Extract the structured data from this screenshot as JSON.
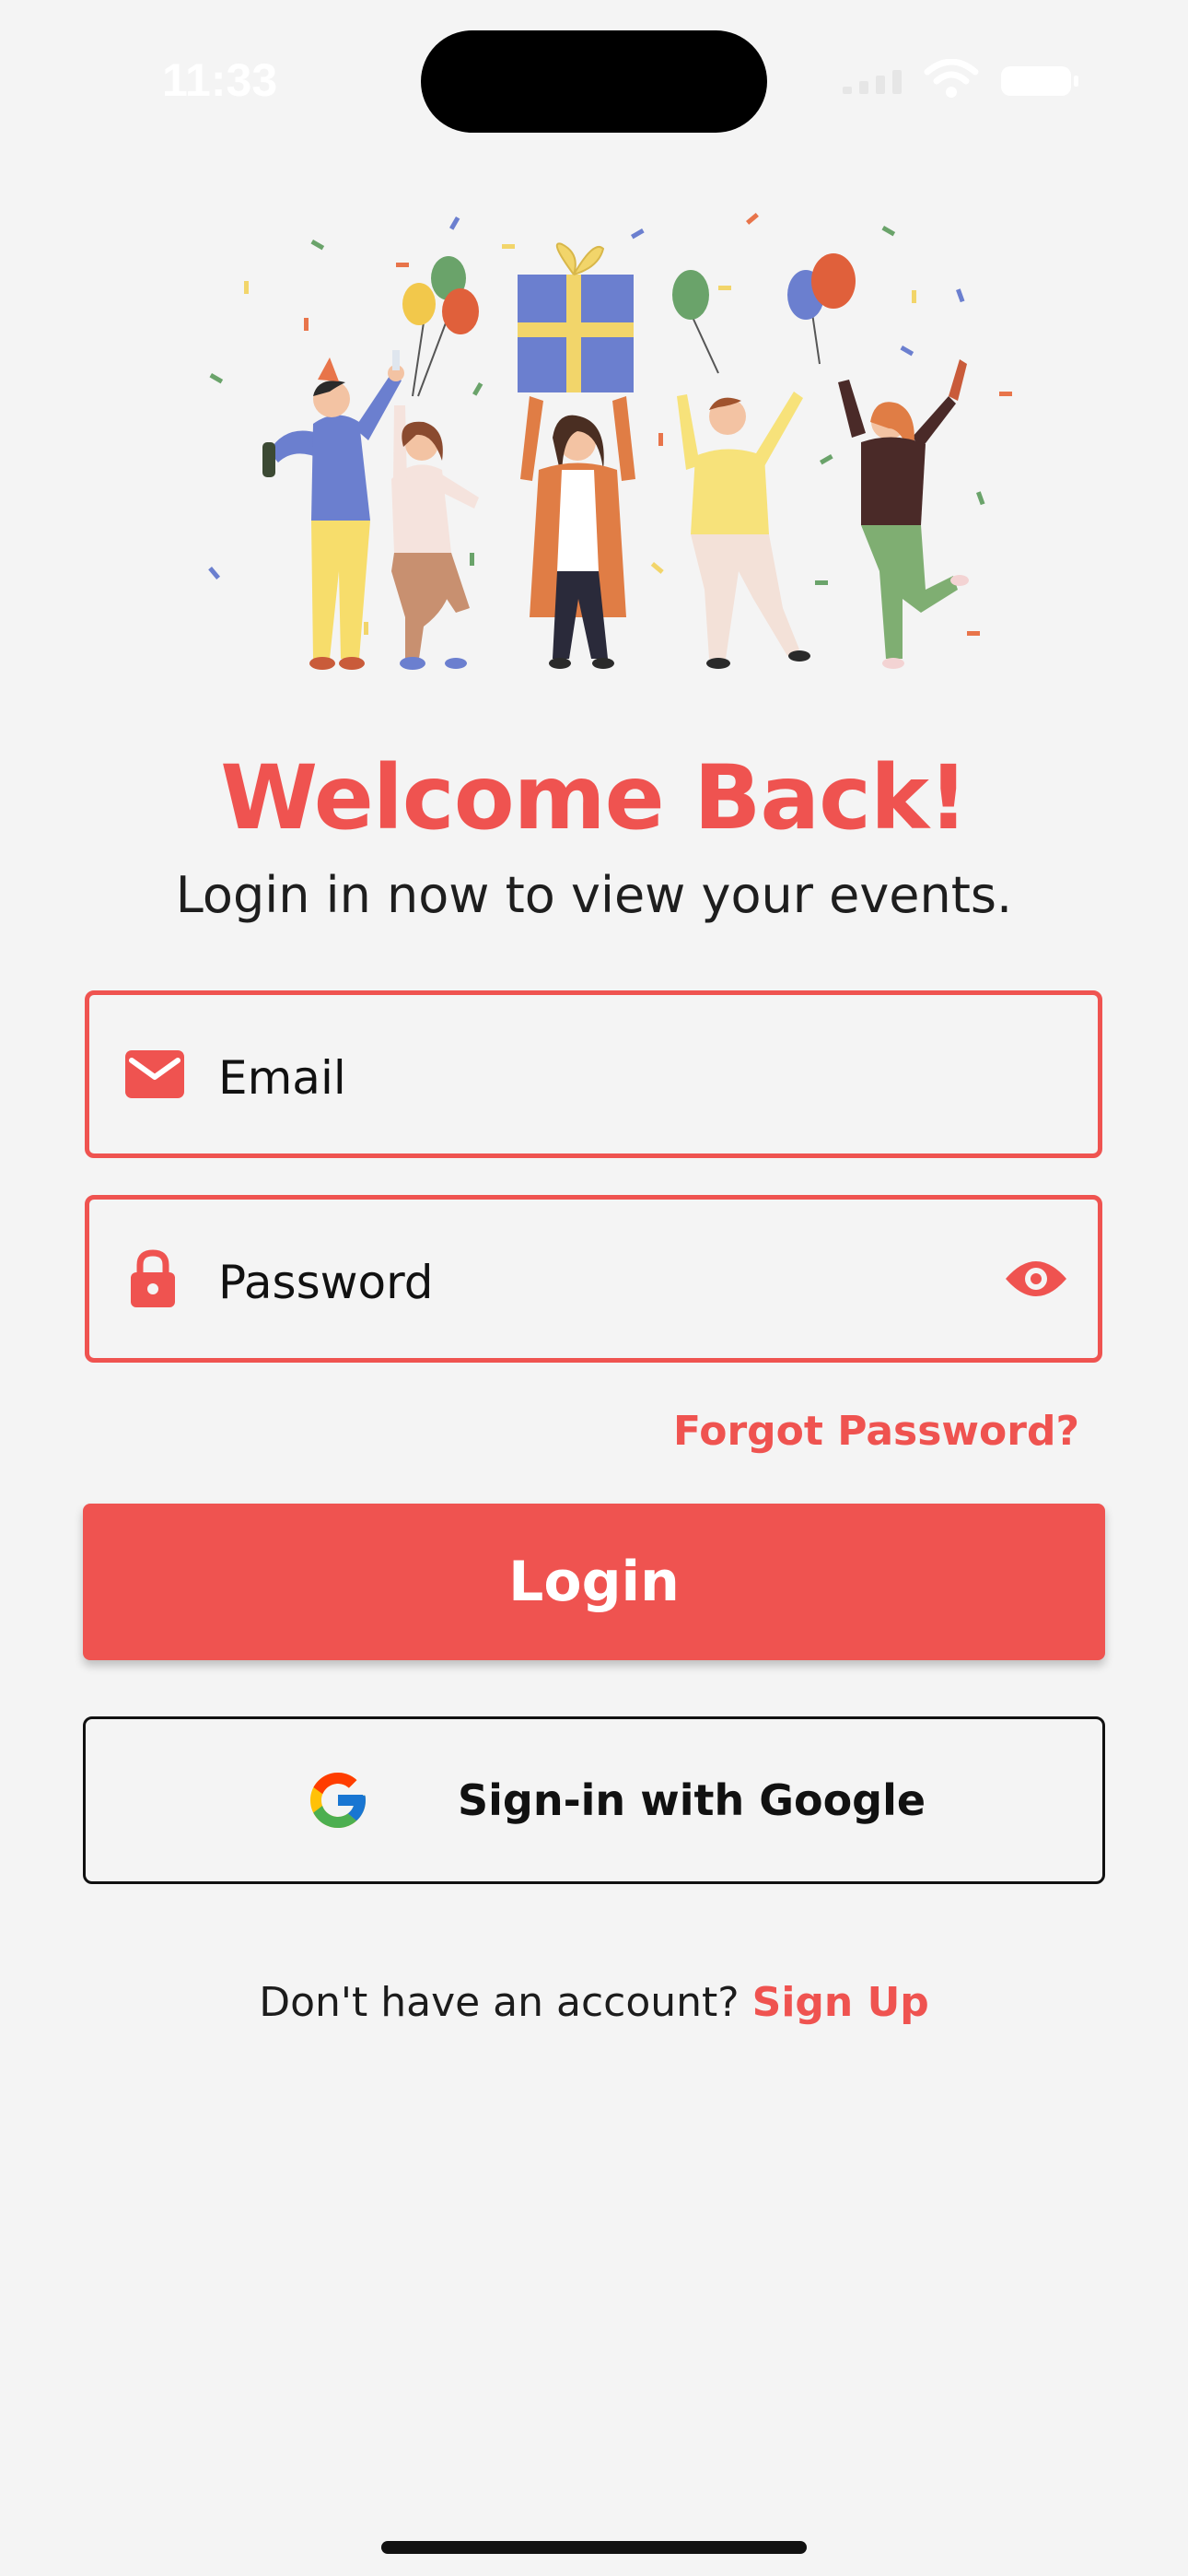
{
  "status_bar": {
    "time": "11:33"
  },
  "hero": {
    "illustration": "party-celebration-illustration"
  },
  "header": {
    "title": "Welcome Back!",
    "subtitle": "Login in now to view your events."
  },
  "form": {
    "email": {
      "placeholder": "Email",
      "value": "",
      "icon": "mail-icon"
    },
    "password": {
      "placeholder": "Password",
      "value": "",
      "icon": "lock-icon",
      "toggle_icon": "eye-icon"
    },
    "forgot_label": "Forgot Password?",
    "login_label": "Login",
    "google_label": "Sign-in with Google"
  },
  "footer": {
    "prompt": "Don't have an account?",
    "signup_label": "Sign Up"
  },
  "colors": {
    "accent": "#ef5350",
    "background": "#f4f4f4",
    "text": "#1c1c1c"
  }
}
